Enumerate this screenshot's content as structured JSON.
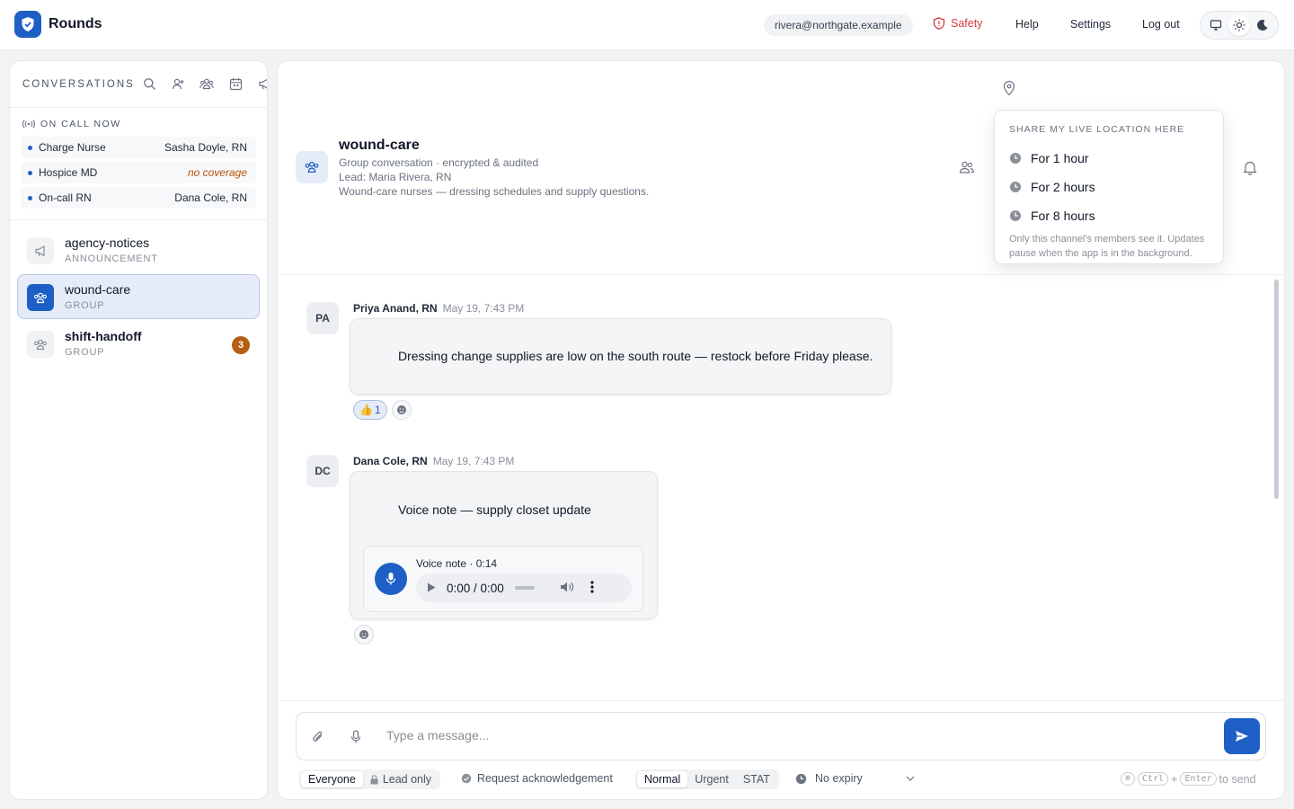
{
  "app": {
    "title": "Rounds"
  },
  "header": {
    "user": "rivera@northgate.example",
    "nav": {
      "safety": "Safety",
      "help": "Help",
      "settings": "Settings",
      "logout": "Log out"
    }
  },
  "sidebar": {
    "title": "CONVERSATIONS",
    "on_call": {
      "title": "ON CALL NOW",
      "rows": [
        {
          "role": "Charge Nurse",
          "name": "Sasha Doyle, RN"
        },
        {
          "role": "Hospice MD",
          "name": "no coverage"
        },
        {
          "role": "On-call RN",
          "name": "Dana Cole, RN"
        }
      ]
    },
    "conversations": [
      {
        "name": "agency-notices",
        "type": "ANNOUNCEMENT"
      },
      {
        "name": "wound-care",
        "type": "GROUP"
      },
      {
        "name": "shift-handoff",
        "type": "GROUP",
        "unread": "3"
      }
    ]
  },
  "channel": {
    "name": "wound-care",
    "meta": "Group conversation · encrypted & audited",
    "lead": "Lead: Maria Rivera, RN",
    "description": "Wound-care nurses — dressing schedules and supply questions."
  },
  "location_popover": {
    "title": "SHARE MY LIVE LOCATION HERE",
    "options": [
      "For 1 hour",
      "For 2 hours",
      "For 8 hours"
    ],
    "note": "Only this channel's members see it. Updates pause when the app is in the background."
  },
  "messages": [
    {
      "initials": "PA",
      "author": "Priya Anand, RN",
      "time": "May 19, 7:43 PM",
      "text": "Dressing change supplies are low on the south route — restock before Friday please.",
      "reaction": {
        "emoji": "👍",
        "count": "1"
      }
    },
    {
      "initials": "DC",
      "author": "Dana Cole, RN",
      "time": "May 19, 7:43 PM",
      "text": "Voice note — supply closet update",
      "voice": {
        "label": "Voice note · 0:14",
        "time": "0:00 / 0:00"
      }
    }
  ],
  "composer": {
    "placeholder": "Type a message...",
    "audience": [
      "Everyone",
      "Lead only"
    ],
    "ack": "Request acknowledgement",
    "priority": [
      "Normal",
      "Urgent",
      "STAT"
    ],
    "expiry": "No expiry",
    "shortcut": {
      "key1": "⌘",
      "key2": "Ctrl",
      "plus": "+",
      "key3": "Enter",
      "suffix": "to send"
    }
  },
  "colors": {
    "accent": "#1d5fc4",
    "danger": "#d23b3b",
    "warning": "#b45f12"
  }
}
